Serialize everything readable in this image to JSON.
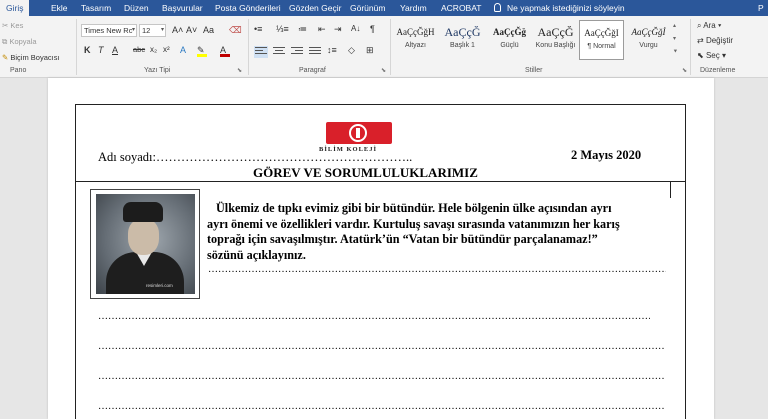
{
  "ribbon_tabs": [
    "Giriş",
    "Ekle",
    "Tasarım",
    "Düzen",
    "Başvurular",
    "Posta Gönderileri",
    "Gözden Geçir",
    "Görünüm",
    "Yardım",
    "ACROBAT"
  ],
  "tell_me": "Ne yapmak istediğinizi söyleyin",
  "user_initial": "P",
  "clipboard": {
    "cut": "Kes",
    "copy": "Kopyala",
    "format_painter": "Biçim Boyacısı",
    "label": "Pano"
  },
  "font": {
    "family": "Times New Rc",
    "size": "12",
    "grow": "A˄",
    "shrink": "A˅",
    "case": "Aa",
    "bold": "K",
    "italic": "T",
    "underline": "A",
    "strike": "abc",
    "subscript": "x₂",
    "superscript": "x²",
    "color_a": "A",
    "label": "Yazı Tipi",
    "highlight_color": "#ffff00",
    "font_color": "#c00000"
  },
  "paragraph": {
    "label": "Paragraf",
    "show_marks": "¶"
  },
  "styles": {
    "label": "Stiller",
    "items": [
      {
        "sample": "AaÇçĞğH",
        "name": "Altyazı"
      },
      {
        "sample": "AaÇçĞ",
        "name": "Başlık 1"
      },
      {
        "sample": "AaÇçĞğ",
        "name": "Güçlü"
      },
      {
        "sample": "AaÇçĞ",
        "name": "Konu Başlığı"
      },
      {
        "sample": "AaÇçĞğI",
        "name": "¶ Normal"
      },
      {
        "sample": "AaÇçĞğİ",
        "name": "Vurgu"
      }
    ]
  },
  "editing": {
    "find": "Ara",
    "replace": "Değiştir",
    "select": "Seç",
    "label": "Düzenleme"
  },
  "document": {
    "logo_text": "BİLİM KOLEJİ",
    "name_line": "Adı soyadı:……………………………………………………..",
    "date": "2 Mayıs 2020",
    "title": "GÖREV VE SORUMLULUKLARIMIZ",
    "photo_site": "resimleri.com",
    "question_lines": [
      "Ülkemiz de tıpkı evimiz gibi bir bütündür. Hele bölgenin ülke açısından ayrı",
      "ayrı önemi ve özellikleri vardır. Kurtuluş savaşı sırasında vatanımızın her karış",
      "toprağı için savaşılmıştır. Atatürk’ün “Vatan bir bütündür parçalanamaz!”",
      "sözünü açıklayınız."
    ],
    "answer_dots": "………………………………………………………………………………………………………………………………………………………………………………………………………………………………………………"
  }
}
